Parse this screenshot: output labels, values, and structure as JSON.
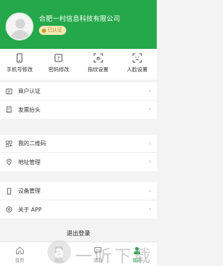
{
  "profile": {
    "company_name": "合肥一村信息科技有限公司",
    "badge": "已认证"
  },
  "quick_actions": [
    {
      "label": "手机号修改",
      "icon": "phone-icon"
    },
    {
      "label": "密码修改",
      "icon": "password-icon"
    },
    {
      "label": "指纹设置",
      "icon": "fingerprint-icon"
    },
    {
      "label": "人脸设置",
      "icon": "face-icon"
    }
  ],
  "menu_groups": [
    [
      {
        "label": "商户认证",
        "icon": "merchant-icon"
      },
      {
        "label": "发票抬头",
        "icon": "invoice-icon"
      }
    ],
    [
      {
        "label": "我的二维码",
        "icon": "qrcode-icon"
      },
      {
        "label": "地址管理",
        "icon": "location-icon"
      }
    ],
    [
      {
        "label": "设备管理",
        "icon": "device-icon"
      },
      {
        "label": "关于 APP",
        "icon": "about-icon"
      }
    ]
  ],
  "logout_label": "退出登录",
  "tabs": [
    {
      "label": "首页",
      "icon": "home-icon",
      "active": false
    },
    {
      "label": "商品",
      "icon": "goods-icon",
      "active": false
    },
    {
      "label": "消息",
      "icon": "message-icon",
      "active": false
    },
    {
      "label": "我的",
      "icon": "profile-icon",
      "active": true
    }
  ],
  "watermark": {
    "glyph": "a",
    "text": "一听下载"
  },
  "colors": {
    "brand": "#25a84a",
    "badge_bg": "#f4e7b4",
    "badge_text": "#b79236"
  }
}
